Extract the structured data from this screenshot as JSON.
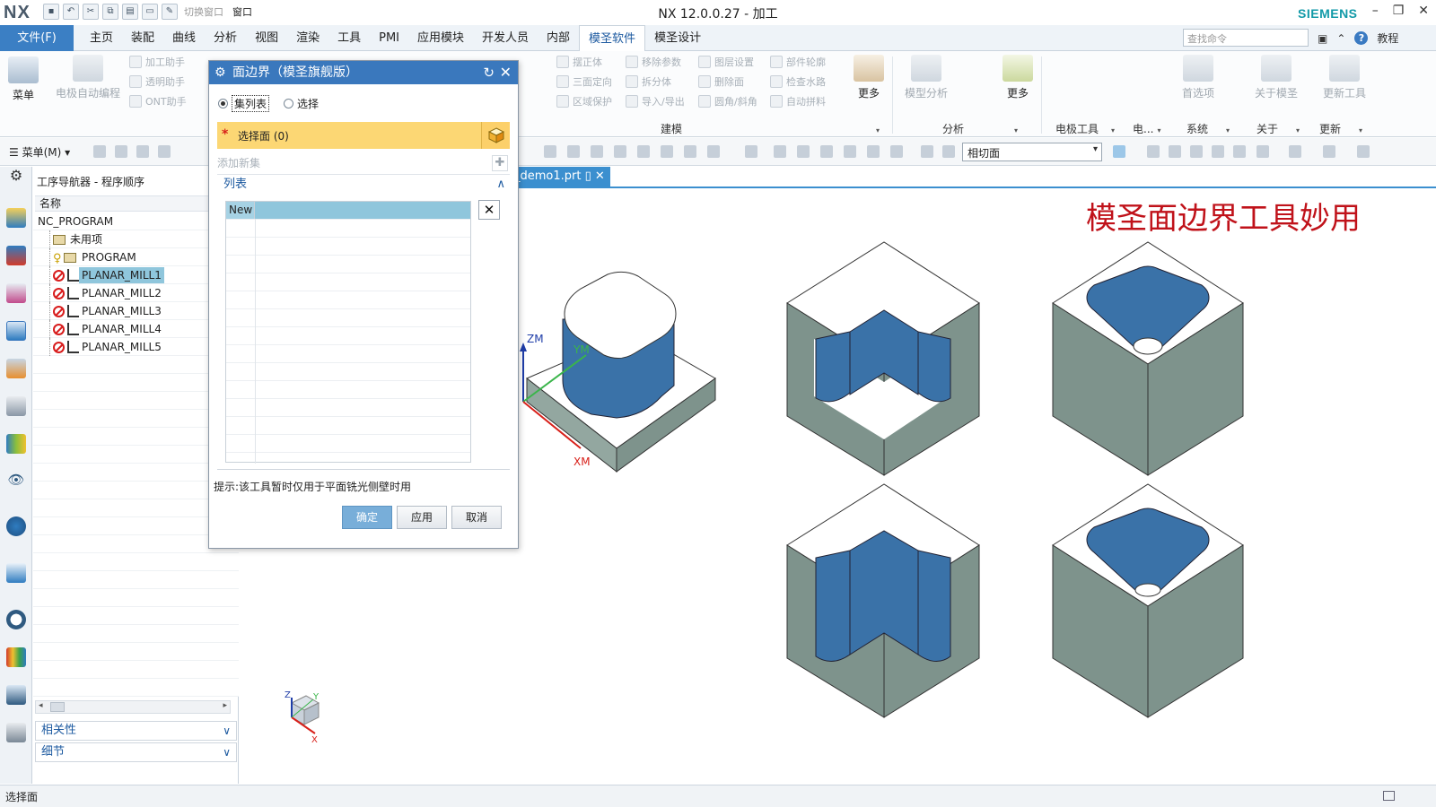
{
  "app": {
    "logo": "NX",
    "title": "NX 12.0.0.27 - 加工",
    "brand": "SIEMENS",
    "quick_access": {
      "switch_window": "切换窗口",
      "window": "窗口"
    }
  },
  "menubar": {
    "file": "文件(F)",
    "tabs": [
      "主页",
      "装配",
      "曲线",
      "分析",
      "视图",
      "渲染",
      "工具",
      "PMI",
      "应用模块",
      "开发人员",
      "内部",
      "模圣软件",
      "模圣设计"
    ],
    "active_tab": "模圣软件",
    "search_placeholder": "查找命令",
    "tutorial": "教程"
  },
  "ribbon": {
    "menu_button": "菜单",
    "electrode_auto": "电极自动编程",
    "small_left": [
      "加工助手",
      "透明助手",
      "ONT助手"
    ],
    "col_a": [
      "摆正体",
      "三面定向",
      "区域保护"
    ],
    "col_b": [
      "移除参数",
      "拆分体",
      "导入/导出"
    ],
    "col_c": [
      "图层设置",
      "删除面",
      "圆角/斜角"
    ],
    "col_d": [
      "部件轮廓",
      "检查水路",
      "自动拼料"
    ],
    "more1": "更多",
    "model_analysis": "模型分析",
    "more2": "更多",
    "first_option": "首选项",
    "about_mosheng": "关于模圣",
    "update_tool": "更新工具",
    "groups": {
      "modeling": "建模",
      "analysis": "分析",
      "electrode_tools": "电极工具",
      "electric": "电...",
      "system": "系统",
      "about": "关于",
      "update": "更新"
    }
  },
  "toolbar2": {
    "menu": "菜单(M)",
    "selection_filter": "相切面"
  },
  "navigator": {
    "title": "工序导航器 - 程序顺序",
    "column": "名称",
    "items": [
      {
        "label": "NC_PROGRAM"
      },
      {
        "label": "未用项"
      },
      {
        "label": "PROGRAM"
      },
      {
        "label": "PLANAR_MILL1"
      },
      {
        "label": "PLANAR_MILL2"
      },
      {
        "label": "PLANAR_MILL3"
      },
      {
        "label": "PLANAR_MILL4"
      },
      {
        "label": "PLANAR_MILL5"
      }
    ],
    "selected": "PLANAR_MILL1",
    "panel_dependency": "相关性",
    "panel_details": "细节"
  },
  "graphics": {
    "file_tab": "_demo1.prt",
    "overlay_title": "模圣面边界工具妙用",
    "axis_labels": {
      "zm": "ZM",
      "ym": "YM",
      "xm": "XM",
      "z": "Z",
      "y": "Y",
      "x": "X"
    }
  },
  "dialog": {
    "title": "面边界（模圣旗舰版）",
    "radio_list": "集列表",
    "radio_select": "选择",
    "select_face": "选择面 (0)",
    "add_new_set": "添加新集",
    "list_header": "列表",
    "table_new": "New",
    "hint": "提示:该工具暂时仅用于平面铣光侧壁时用",
    "ok": "确定",
    "apply": "应用",
    "cancel": "取消"
  },
  "status": {
    "text": "选择面"
  },
  "colors": {
    "accent": "#3a78bd",
    "select_highlight": "#fcd774",
    "title_red": "#c0121a",
    "face_blue": "#3a72a8",
    "face_gray": "#7e938c"
  }
}
